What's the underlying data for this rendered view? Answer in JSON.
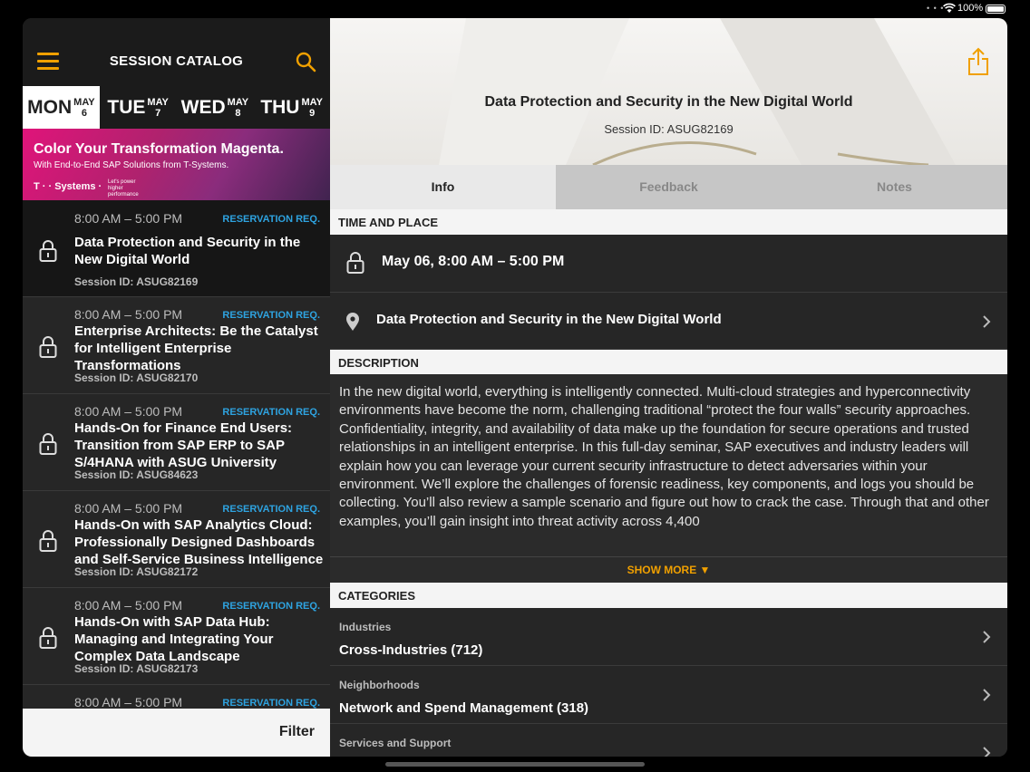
{
  "status": {
    "battery": "100%"
  },
  "header": {
    "title": "SESSION CATALOG"
  },
  "days": [
    {
      "name": "MON",
      "month": "MAY",
      "date": "6",
      "active": true
    },
    {
      "name": "TUE",
      "month": "MAY",
      "date": "7",
      "active": false
    },
    {
      "name": "WED",
      "month": "MAY",
      "date": "8",
      "active": false
    },
    {
      "name": "THU",
      "month": "MAY",
      "date": "9",
      "active": false
    }
  ],
  "banner": {
    "headline": "Color Your Transformation Magenta.",
    "subline": "With End-to-End SAP Solutions from T-Systems.",
    "brand": "T · · Systems ·",
    "tagline": "Let's power higher performance"
  },
  "sessions": [
    {
      "time": "8:00 AM – 5:00 PM",
      "badge": "RESERVATION REQ.",
      "title": "Data Protection and Security in the New Digital World",
      "session_id": "Session ID: ASUG82169"
    },
    {
      "time": "8:00 AM – 5:00 PM",
      "badge": "RESERVATION REQ.",
      "title": "Enterprise Architects: Be the Catalyst for Intelligent Enterprise Transformations",
      "session_id": "Session ID: ASUG82170"
    },
    {
      "time": "8:00 AM – 5:00 PM",
      "badge": "RESERVATION REQ.",
      "title": "Hands-On for Finance End Users: Transition from SAP ERP to SAP S/4HANA with ASUG University",
      "session_id": "Session ID: ASUG84623"
    },
    {
      "time": "8:00 AM – 5:00 PM",
      "badge": "RESERVATION REQ.",
      "title": "Hands-On with SAP Analytics Cloud: Professionally Designed Dashboards and Self-Service Business Intelligence",
      "session_id": "Session ID: ASUG82172"
    },
    {
      "time": "8:00 AM – 5:00 PM",
      "badge": "RESERVATION REQ.",
      "title": "Hands-On with SAP Data Hub: Managing and Integrating Your Complex Data Landscape",
      "session_id": "Session ID: ASUG82173"
    },
    {
      "time": "8:00 AM – 5:00 PM",
      "badge": "RESERVATION REQ.",
      "title": "",
      "session_id": ""
    }
  ],
  "filter": {
    "label": "Filter"
  },
  "detail": {
    "title": "Data Protection and Security in the New Digital World",
    "session_id": "Session ID: ASUG82169",
    "tabs": [
      "Info",
      "Feedback",
      "Notes"
    ],
    "time_place_header": "TIME AND PLACE",
    "datetime": "May 06, 8:00 AM – 5:00 PM",
    "location": "Data Protection and Security in the New Digital World",
    "description_header": "DESCRIPTION",
    "description": "In the new digital world, everything is intelligently connected. Multi-cloud strategies and hyperconnectivity environments have become the norm, challenging traditional “protect the four walls” security approaches. Confidentiality, integrity, and availability of data make up the foundation for secure operations and trusted relationships in an intelligent enterprise. In this full-day seminar, SAP executives and industry leaders will explain how you can leverage your current security infrastructure to detect adversaries within your environment. We’ll explore the challenges of forensic readiness, key components, and logs you should be collecting. You’ll also review a sample scenario and figure out how to crack the case. Through that and other examples, you’ll gain insight into threat activity across 4,400",
    "show_more": "SHOW MORE ▼",
    "categories_header": "CATEGORIES",
    "categories": [
      {
        "label": "Industries",
        "value": "Cross-Industries (712)"
      },
      {
        "label": "Neighborhoods",
        "value": "Network and Spend Management (318)"
      },
      {
        "label": "Services and Support",
        "value": ""
      }
    ]
  },
  "colors": {
    "accent": "#f0a000",
    "link": "#2ea3e0",
    "magenta": "#e0147a"
  }
}
